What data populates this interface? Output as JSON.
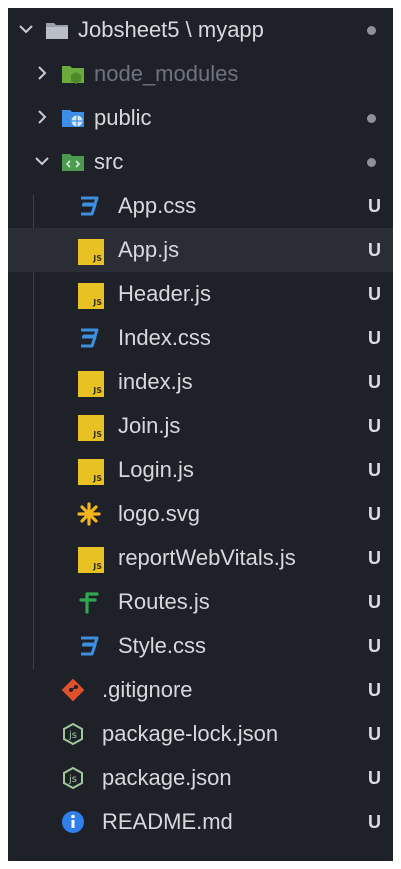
{
  "explorer": {
    "root": {
      "label": "Jobsheet5 \\ myapp",
      "expanded": true,
      "status": "dot"
    },
    "items": [
      {
        "label": "node_modules",
        "kind": "folder",
        "icon": "node-folder-icon",
        "expanded": false,
        "dimmed": true,
        "status": ""
      },
      {
        "label": "public",
        "kind": "folder",
        "icon": "public-folder-icon",
        "expanded": false,
        "status": "dot"
      },
      {
        "label": "src",
        "kind": "folder",
        "icon": "src-folder-icon",
        "expanded": true,
        "status": "dot"
      },
      {
        "label": "App.css",
        "kind": "file",
        "icon": "css-icon",
        "status": "U"
      },
      {
        "label": "App.js",
        "kind": "file",
        "icon": "js-icon",
        "status": "U",
        "selected": true
      },
      {
        "label": "Header.js",
        "kind": "file",
        "icon": "js-icon",
        "status": "U"
      },
      {
        "label": "Index.css",
        "kind": "file",
        "icon": "css-icon",
        "status": "U"
      },
      {
        "label": "index.js",
        "kind": "file",
        "icon": "js-icon",
        "status": "U"
      },
      {
        "label": "Join.js",
        "kind": "file",
        "icon": "js-icon",
        "status": "U"
      },
      {
        "label": "Login.js",
        "kind": "file",
        "icon": "js-icon",
        "status": "U"
      },
      {
        "label": "logo.svg",
        "kind": "file",
        "icon": "svg-icon",
        "status": "U"
      },
      {
        "label": "reportWebVitals.js",
        "kind": "file",
        "icon": "js-icon",
        "status": "U"
      },
      {
        "label": "Routes.js",
        "kind": "file",
        "icon": "routes-icon",
        "status": "U"
      },
      {
        "label": "Style.css",
        "kind": "file",
        "icon": "css-icon",
        "status": "U"
      },
      {
        "label": ".gitignore",
        "kind": "file",
        "icon": "git-icon",
        "status": "U"
      },
      {
        "label": "package-lock.json",
        "kind": "file",
        "icon": "npm-json-icon",
        "status": "U"
      },
      {
        "label": "package.json",
        "kind": "file",
        "icon": "npm-json-icon",
        "status": "U"
      },
      {
        "label": "README.md",
        "kind": "file",
        "icon": "info-icon",
        "status": "U"
      }
    ],
    "colors": {
      "background": "#1f2129",
      "selected_row": "#2a2d36",
      "text": "#d6d8de",
      "js_badge": "#e8c225",
      "css_icon": "#3d8fe0",
      "git_icon": "#e0502c",
      "info_icon": "#2f80ed",
      "routes_icon": "#2fa84f"
    }
  }
}
